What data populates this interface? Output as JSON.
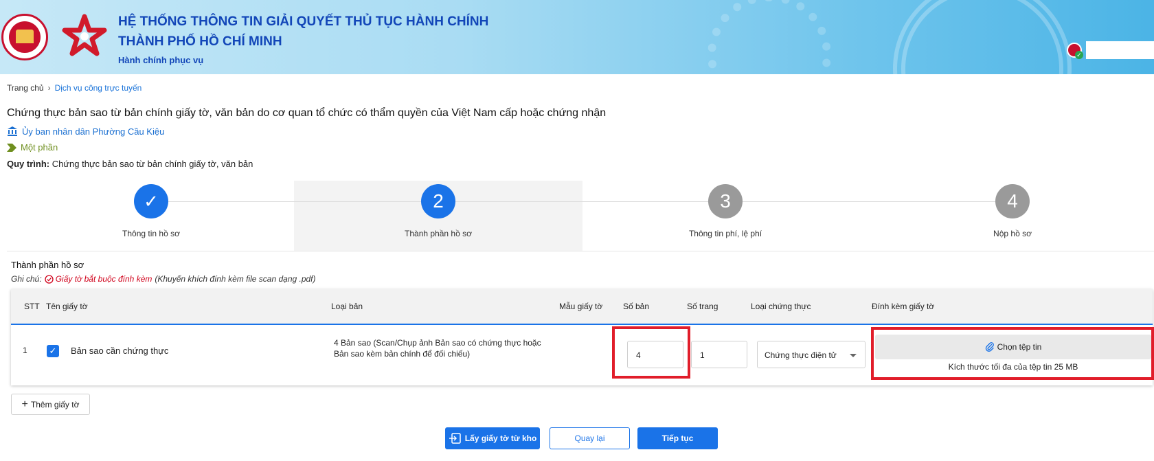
{
  "header": {
    "title_line1": "HỆ THỐNG THÔNG TIN GIẢI QUYẾT THỦ TỤC HÀNH CHÍNH",
    "title_line2": "THÀNH PHỐ HỒ CHÍ MINH",
    "subtitle": "Hành chính phục vụ"
  },
  "breadcrumb": {
    "home": "Trang chủ",
    "current": "Dịch vụ công trực tuyến"
  },
  "procedure": {
    "title": "Chứng thực bản sao từ bản chính giấy tờ, văn bản do cơ quan tổ chức có thẩm quyền của Việt Nam cấp hoặc chứng nhận",
    "agency": "Ủy ban nhân dân Phường Cầu Kiệu",
    "level": "Một phần",
    "process_label": "Quy trình:",
    "process_value": "Chứng thực bản sao từ bản chính giấy tờ, văn bản"
  },
  "steps": [
    {
      "number": "✓",
      "label": "Thông tin hồ sơ",
      "state": "done"
    },
    {
      "number": "2",
      "label": "Thành phần hồ sơ",
      "state": "active"
    },
    {
      "number": "3",
      "label": "Thông tin phí, lệ phí",
      "state": "todo"
    },
    {
      "number": "4",
      "label": "Nộp hồ sơ",
      "state": "todo"
    }
  ],
  "section": {
    "title": "Thành phần hồ sơ",
    "note_label": "Ghi chú:",
    "note_required": "Giấy tờ bắt buộc đính kèm",
    "note_hint": "(Khuyến khích đính kèm file scan dạng .pdf)"
  },
  "table": {
    "headers": {
      "stt": "STT",
      "name": "Tên giấy tờ",
      "type": "Loại bản",
      "template": "Mẫu giấy tờ",
      "copies": "Số bản",
      "pages": "Số trang",
      "cert_type": "Loại chứng thực",
      "attach": "Đính kèm giấy tờ"
    },
    "rows": [
      {
        "stt": "1",
        "name": "Bản sao cần chứng thực",
        "type": "4 Bản sao (Scan/Chụp ảnh Bản sao có chứng thực hoặc Bản sao kèm bản chính để đối chiếu)",
        "copies": "4",
        "pages": "1",
        "cert_type": "Chứng thực điện tử",
        "choose_file": "Chọn tệp tin",
        "max_size": "Kích thước tối đa của tệp tin 25 MB"
      }
    ]
  },
  "actions": {
    "add": "Thêm giấy tờ",
    "get_from_store": "Lấy giấy tờ từ kho",
    "back": "Quay lại",
    "next": "Tiếp tục"
  },
  "colors": {
    "primary": "#1a73e8",
    "header_text": "#1246b8",
    "highlight": "#e11d2a",
    "required": "#d0021b"
  }
}
